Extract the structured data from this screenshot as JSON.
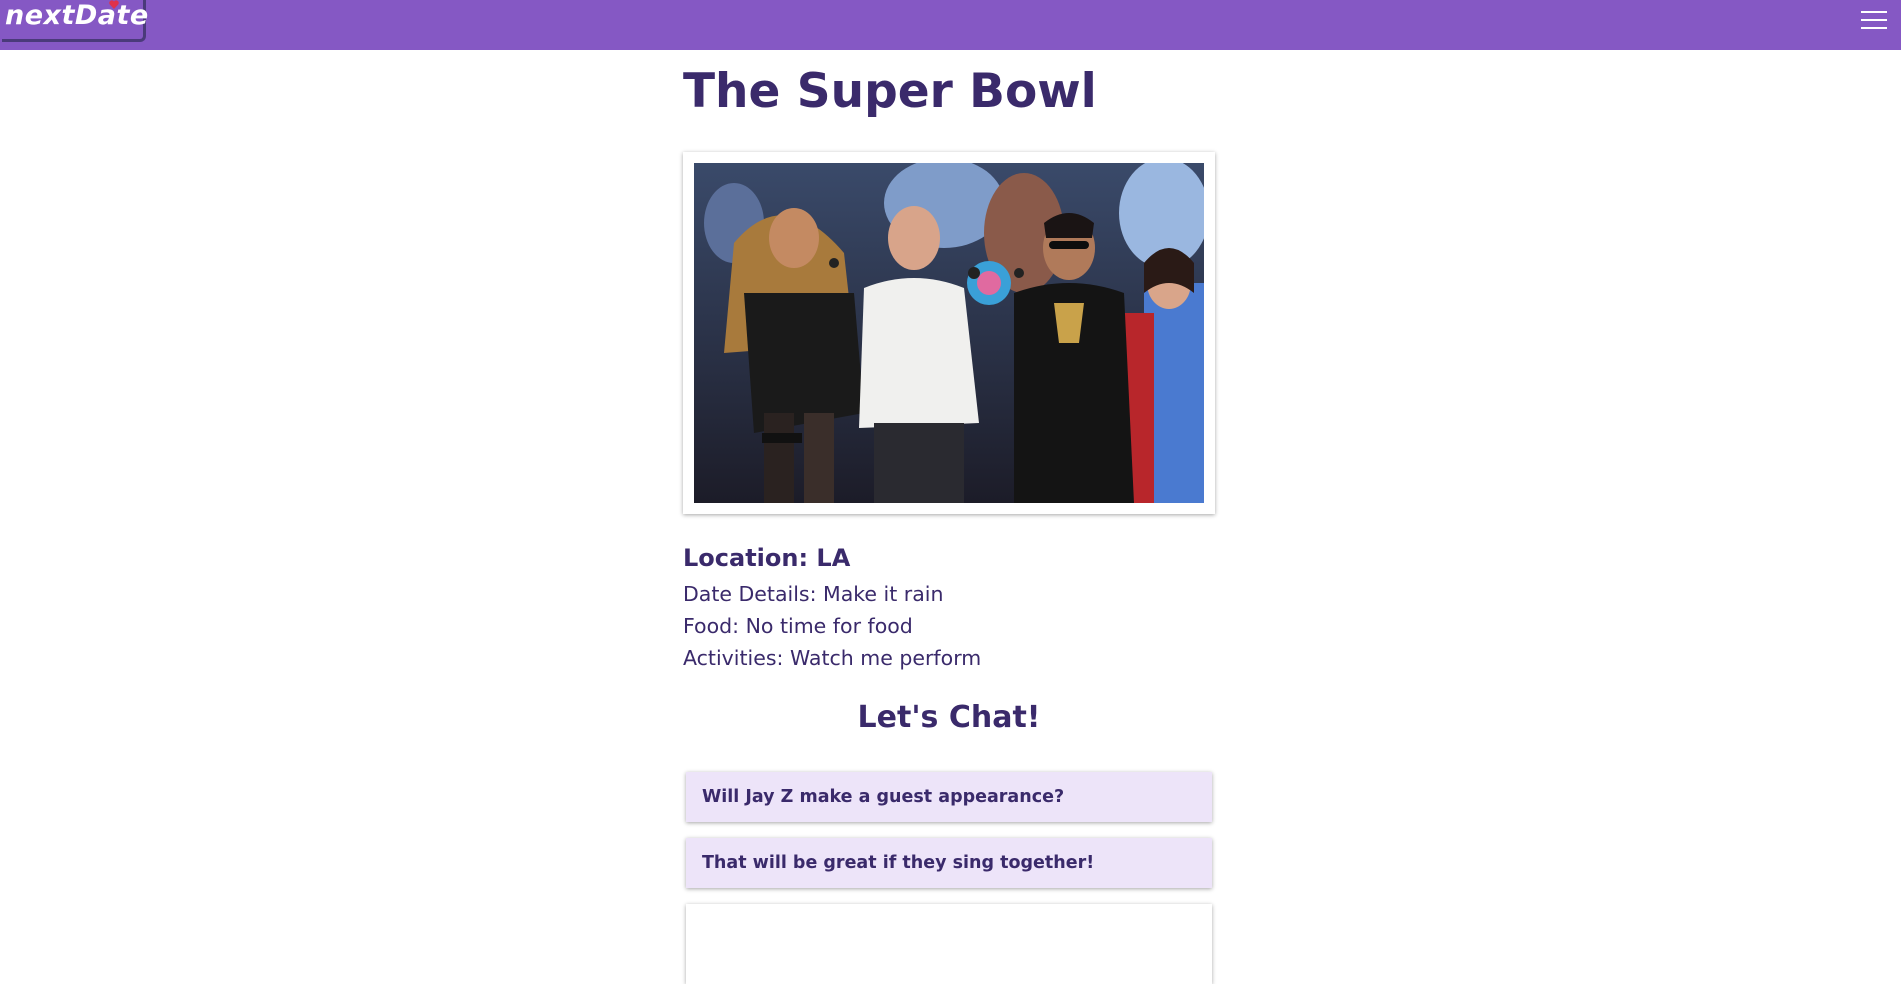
{
  "brand": {
    "name": "nextDate"
  },
  "nav": {
    "menu_icon": "hamburger-menu-icon"
  },
  "date": {
    "title": "The Super Bowl",
    "photo_alt": "Beyoncé, Chris Martin and Bruno Mars performing",
    "location": "Location: LA",
    "details": "Date Details: Make it rain",
    "food": "Food: No time for food",
    "activities": "Activities: Watch me perform"
  },
  "chat": {
    "title": "Let's Chat!",
    "messages": [
      "Will Jay Z make a guest appearance?",
      "That will be great if they sing together!"
    ],
    "input_placeholder": ""
  },
  "colors": {
    "navbar": "#8558c4",
    "text": "#3a2a6b",
    "message_bg": "#ede4f9",
    "logo_heart": "#e0314b"
  }
}
